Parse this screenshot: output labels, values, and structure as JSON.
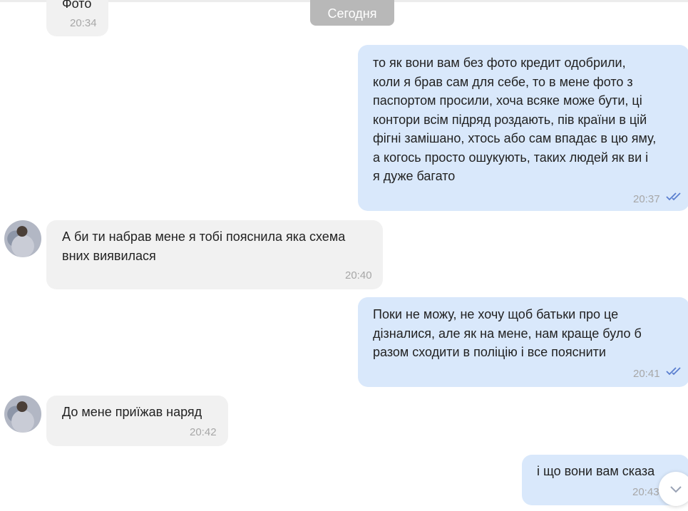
{
  "date_separator": "Сегодня",
  "messages": [
    {
      "text": "Фото",
      "time": "20:34"
    },
    {
      "text": "то як вони вам без фото кредит одобрили,\nколи я брав сам для себе, то в мене фото з\nпаспортом просили, хоча всяке може бути, ці\nконтори всім підряд роздають, пів країни в цій\nфігні замішано, хтось або сам впадає в цю яму,\nа когось просто ошукують, таких людей як ви і\nя дуже багато",
      "time": "20:37"
    },
    {
      "text": "А би ти набрав мене я тобі пояснила яка схема\nвних виявилася",
      "time": "20:40"
    },
    {
      "text": "Поки не можу, не хочу щоб батьки про це\nдізналися, але як на мене, нам краще було б\nразом сходити в поліцію і все пояснити",
      "time": "20:41"
    },
    {
      "text": "До мене приїжав наряд",
      "time": "20:42"
    },
    {
      "text": "і що вони вам сказа",
      "time": "20:43"
    }
  ],
  "icons": {
    "read_ticks": "double-check-icon",
    "scroll_down": "arrow-down-icon",
    "avatar": "contact-avatar"
  },
  "colors": {
    "incoming": "#f1f1f1",
    "outgoing": "#d9e8fb",
    "ticks": "#5b7fcf"
  }
}
